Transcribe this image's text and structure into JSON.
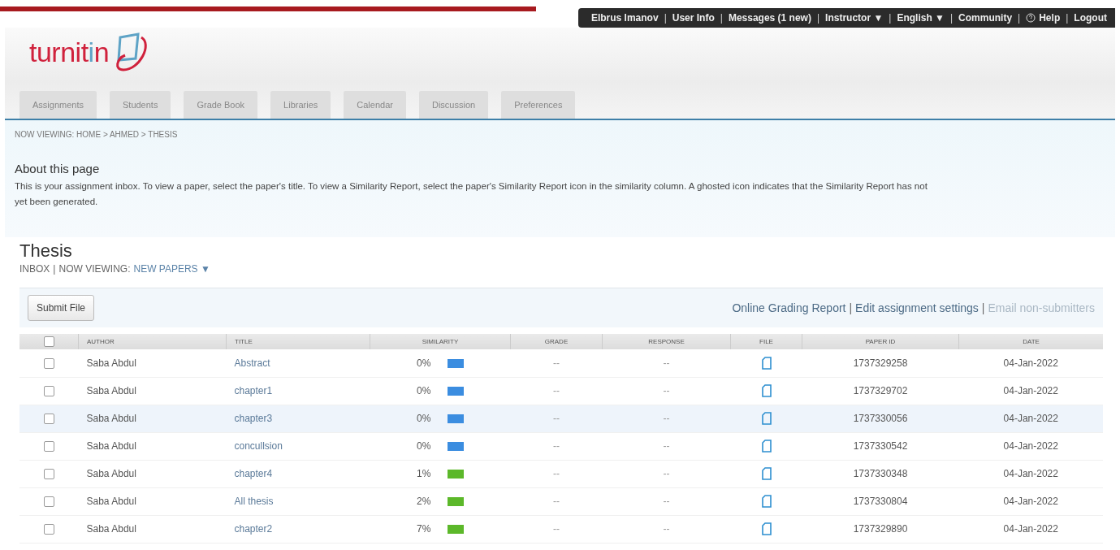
{
  "top_nav": {
    "separator": "|",
    "items": [
      {
        "label": "Elbrus Imanov",
        "kind": "text"
      },
      {
        "label": "User Info",
        "kind": "link"
      },
      {
        "label": "Messages (1 new)",
        "kind": "link"
      },
      {
        "label": "Instructor ▼",
        "kind": "link"
      },
      {
        "label": "English ▼",
        "kind": "link"
      },
      {
        "label": "Community",
        "kind": "link"
      },
      {
        "label": "Help",
        "kind": "help"
      },
      {
        "label": "Logout",
        "kind": "link"
      }
    ]
  },
  "logo": {
    "text": "turnit",
    "accent": "i",
    "rest": "n"
  },
  "tabs": [
    {
      "label": "Assignments",
      "selected": false
    },
    {
      "label": "Students",
      "selected": false
    },
    {
      "label": "Grade Book",
      "selected": false
    },
    {
      "label": "Libraries",
      "selected": false
    },
    {
      "label": "Calendar",
      "selected": false
    },
    {
      "label": "Discussion",
      "selected": false
    },
    {
      "label": "Preferences",
      "selected": false
    }
  ],
  "breadcrumb": "NOW VIEWING: HOME > AHMED > THESIS",
  "about": {
    "title": "About this page",
    "text": "This is your assignment inbox. To view a paper, select the paper's title. To view a Similarity Report, select the paper's Similarity Report icon in the similarity column. A ghosted icon indicates that the Similarity Report has not yet been generated."
  },
  "assignment": {
    "title": "Thesis",
    "inbox": "INBOX",
    "separator": "|",
    "viewing_label": "NOW VIEWING:",
    "viewing_value": "NEW PAPERS ▼"
  },
  "toolbar": {
    "submit_button": "Submit File",
    "separator": "|",
    "links": [
      {
        "label": "Online Grading Report",
        "disabled": false
      },
      {
        "label": "Edit assignment settings",
        "disabled": false
      },
      {
        "label": "Email non-submitters",
        "disabled": true
      }
    ]
  },
  "table": {
    "header_checked": false,
    "columns": [
      "AUTHOR",
      "TITLE",
      "SIMILARITY",
      "GRADE",
      "RESPONSE",
      "FILE",
      "PAPER ID",
      "DATE"
    ],
    "rows": [
      {
        "checked": false,
        "highlighted": false,
        "author": "Saba Abdul",
        "title": "Abstract",
        "similarity": "0%",
        "color": "#3b8de0",
        "grade": "--",
        "response": "--",
        "paper_id": "1737329258",
        "date": "04-Jan-2022"
      },
      {
        "checked": false,
        "highlighted": false,
        "author": "Saba Abdul",
        "title": "chapter1",
        "similarity": "0%",
        "color": "#3b8de0",
        "grade": "--",
        "response": "--",
        "paper_id": "1737329702",
        "date": "04-Jan-2022"
      },
      {
        "checked": false,
        "highlighted": true,
        "author": "Saba Abdul",
        "title": "chapter3",
        "similarity": "0%",
        "color": "#3b8de0",
        "grade": "--",
        "response": "--",
        "paper_id": "1737330056",
        "date": "04-Jan-2022"
      },
      {
        "checked": false,
        "highlighted": false,
        "author": "Saba Abdul",
        "title": "concullsion",
        "similarity": "0%",
        "color": "#3b8de0",
        "grade": "--",
        "response": "--",
        "paper_id": "1737330542",
        "date": "04-Jan-2022"
      },
      {
        "checked": false,
        "highlighted": false,
        "author": "Saba Abdul",
        "title": "chapter4",
        "similarity": "1%",
        "color": "#5cb82a",
        "grade": "--",
        "response": "--",
        "paper_id": "1737330348",
        "date": "04-Jan-2022"
      },
      {
        "checked": false,
        "highlighted": false,
        "author": "Saba Abdul",
        "title": "All thesis",
        "similarity": "2%",
        "color": "#5cb82a",
        "grade": "--",
        "response": "--",
        "paper_id": "1737330804",
        "date": "04-Jan-2022"
      },
      {
        "checked": false,
        "highlighted": false,
        "author": "Saba Abdul",
        "title": "chapter2",
        "similarity": "7%",
        "color": "#5cb82a",
        "grade": "--",
        "response": "--",
        "paper_id": "1737329890",
        "date": "04-Jan-2022"
      }
    ]
  }
}
